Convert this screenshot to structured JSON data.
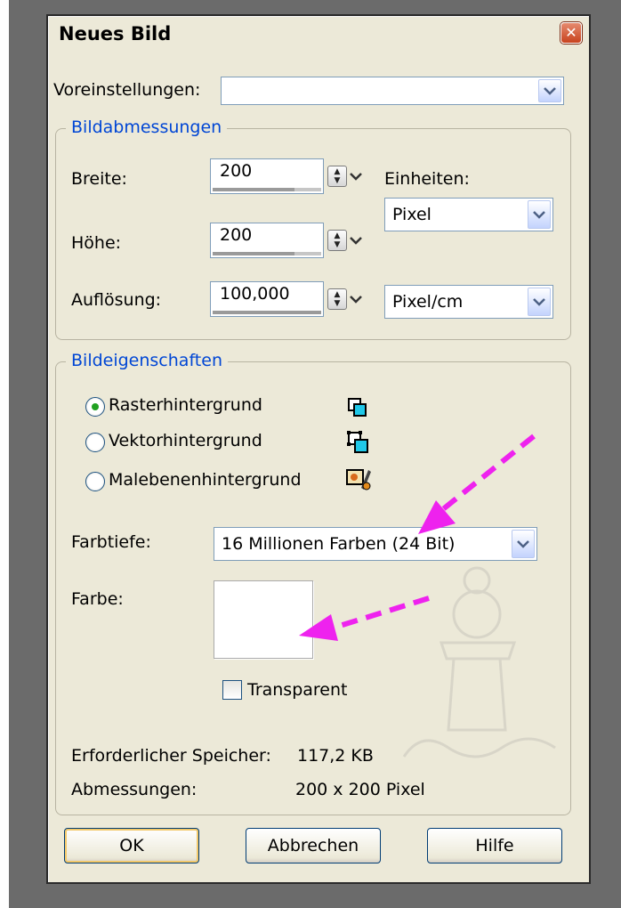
{
  "dialog": {
    "title": "Neues Bild"
  },
  "presets": {
    "label": "Voreinstellungen:",
    "value": ""
  },
  "dimensions": {
    "legend": "Bildabmessungen",
    "width_label": "Breite:",
    "width_value": "200",
    "height_label": "Höhe:",
    "height_value": "200",
    "resolution_label": "Auflösung:",
    "resolution_value": "100,000",
    "units_label": "Einheiten:",
    "units_value": "Pixel",
    "resolution_unit_value": "Pixel/cm"
  },
  "properties": {
    "legend": "Bildeigenschaften",
    "options": [
      {
        "label": "Rasterhintergrund",
        "selected": true,
        "icon": "raster-layer-icon"
      },
      {
        "label": "Vektorhintergrund",
        "selected": false,
        "icon": "vector-layer-icon"
      },
      {
        "label": "Malebenenhintergrund",
        "selected": false,
        "icon": "art-media-layer-icon"
      }
    ],
    "color_depth_label": "Farbtiefe:",
    "color_depth_value": "16 Millionen Farben (24 Bit)",
    "color_label": "Farbe:",
    "color_value": "#ffffff",
    "transparent_label": "Transparent",
    "transparent_checked": false,
    "memory_label": "Erforderlicher Speicher:",
    "memory_value": "117,2 KB",
    "size_label": "Abmessungen:",
    "size_value": "200 x 200 Pixel"
  },
  "buttons": {
    "ok": "OK",
    "cancel": "Abbrechen",
    "help": "Hilfe"
  },
  "colors": {
    "accent_arrow": "#ee22ee",
    "legend_blue": "#0046d5",
    "dialog_bg": "#ECE9D8"
  }
}
